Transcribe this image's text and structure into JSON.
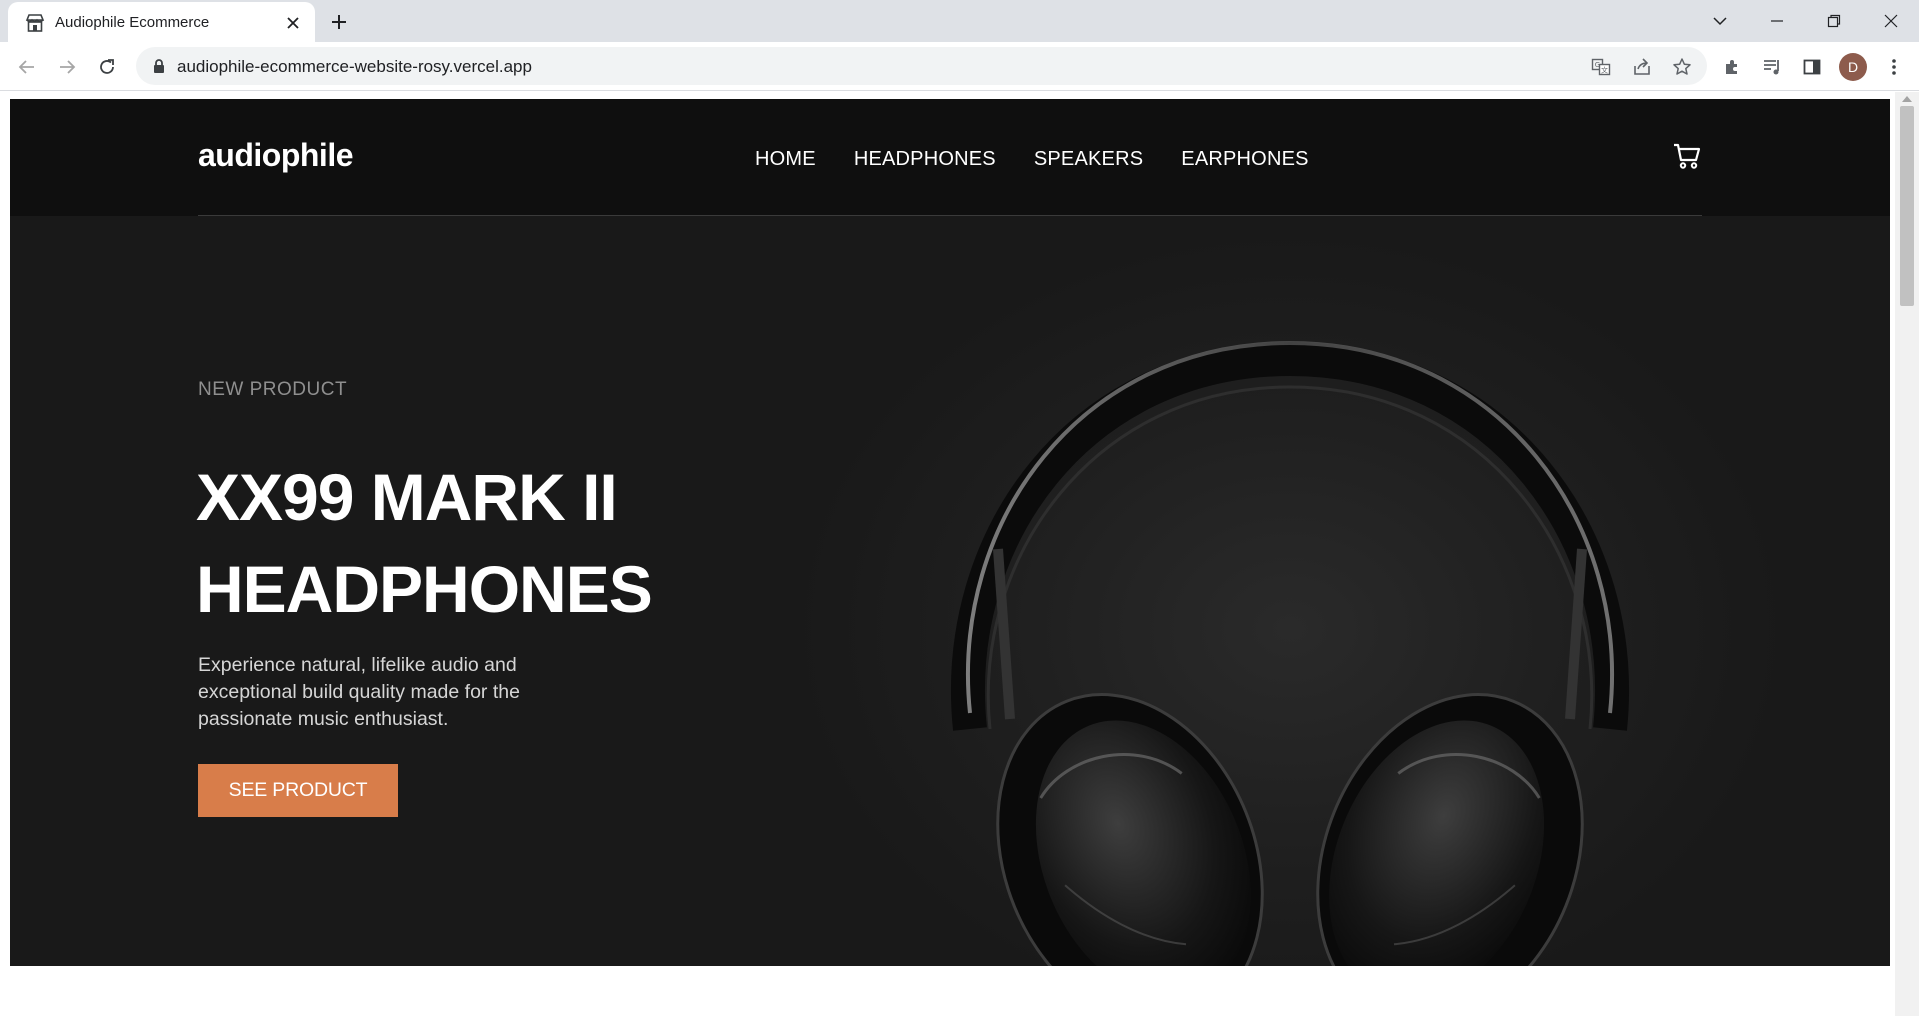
{
  "browser": {
    "tab_title": "Audiophile Ecommerce",
    "url": "audiophile-ecommerce-website-rosy.vercel.app",
    "profile_initial": "D"
  },
  "site": {
    "logo": "audiophile",
    "nav": [
      "HOME",
      "HEADPHONES",
      "SPEAKERS",
      "EARPHONES"
    ]
  },
  "hero": {
    "overline": "NEW PRODUCT",
    "title_line1": "XX99 MARK II",
    "title_line2": "HEADPHONES",
    "description": "Experience natural, lifelike audio and exceptional build quality made for the passionate music enthusiast.",
    "cta_label": "SEE PRODUCT"
  },
  "colors": {
    "accent": "#d87d4a",
    "header_bg": "#0f0f0f",
    "hero_bg": "#191919"
  }
}
